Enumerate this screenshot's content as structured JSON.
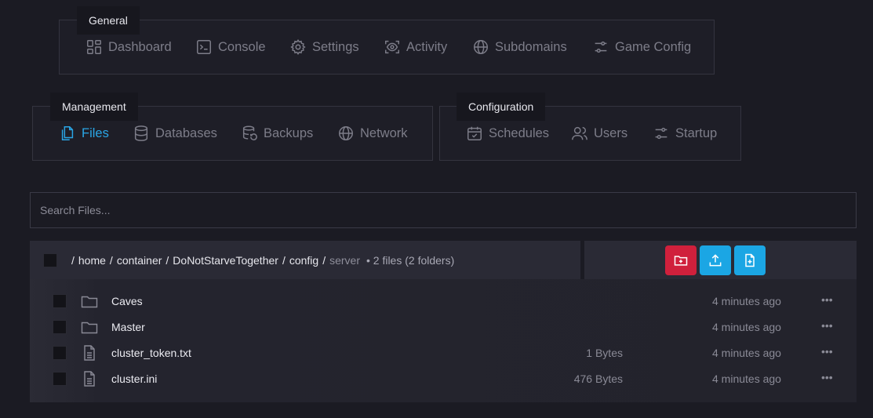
{
  "nav_groups": {
    "general": {
      "label": "General",
      "items": [
        {
          "label": "Dashboard",
          "icon": "dashboard-icon"
        },
        {
          "label": "Console",
          "icon": "console-icon"
        },
        {
          "label": "Settings",
          "icon": "gear-icon"
        },
        {
          "label": "Activity",
          "icon": "activity-icon"
        },
        {
          "label": "Subdomains",
          "icon": "globe-icon"
        },
        {
          "label": "Game Config",
          "icon": "sliders-icon"
        }
      ]
    },
    "management": {
      "label": "Management",
      "items": [
        {
          "label": "Files",
          "icon": "file-icon",
          "active": true
        },
        {
          "label": "Databases",
          "icon": "database-icon"
        },
        {
          "label": "Backups",
          "icon": "backup-icon"
        },
        {
          "label": "Network",
          "icon": "globe-icon"
        }
      ]
    },
    "configuration": {
      "label": "Configuration",
      "items": [
        {
          "label": "Schedules",
          "icon": "calendar-icon"
        },
        {
          "label": "Users",
          "icon": "users-icon"
        },
        {
          "label": "Startup",
          "icon": "sliders-icon"
        }
      ]
    }
  },
  "search": {
    "placeholder": "Search Files...",
    "value": ""
  },
  "breadcrumb": {
    "parts": [
      "home",
      "container",
      "DoNotStarveTogether",
      "config"
    ],
    "current": "server",
    "summary": "• 2 files (2 folders)"
  },
  "actions": [
    {
      "name": "new-folder",
      "icon": "folder-plus-icon",
      "color": "#d0203c"
    },
    {
      "name": "upload",
      "icon": "upload-icon",
      "color": "#1ba6e4"
    },
    {
      "name": "new-file",
      "icon": "file-plus-icon",
      "color": "#1ba6e4"
    }
  ],
  "files": [
    {
      "name": "Caves",
      "type": "folder",
      "size": "",
      "modified": "4 minutes ago"
    },
    {
      "name": "Master",
      "type": "folder",
      "size": "",
      "modified": "4 minutes ago"
    },
    {
      "name": "cluster_token.txt",
      "type": "file",
      "size": "1 Bytes",
      "modified": "4 minutes ago"
    },
    {
      "name": "cluster.ini",
      "type": "file",
      "size": "476 Bytes",
      "modified": "4 minutes ago"
    }
  ],
  "row_menu_label": "•••",
  "colors": {
    "background": "#1b1b23",
    "accent": "#2aa6e6",
    "danger": "#d0203c"
  }
}
